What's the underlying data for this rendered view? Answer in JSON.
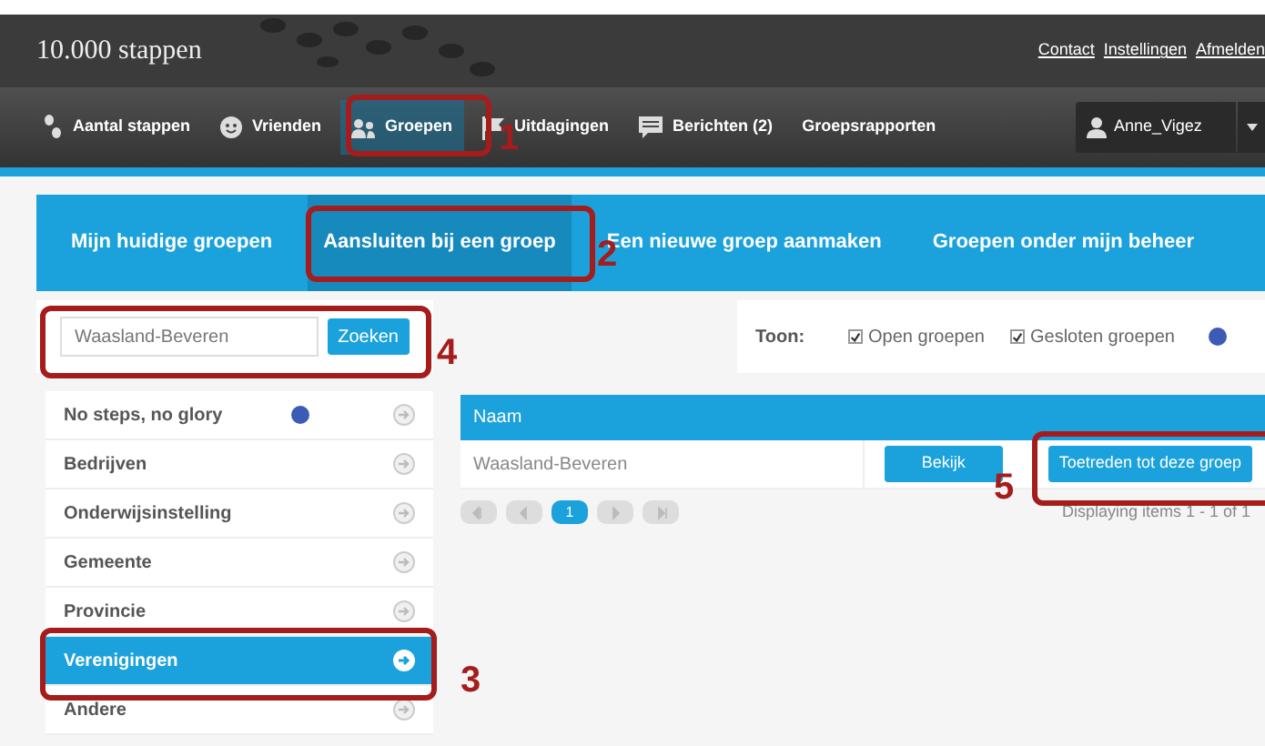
{
  "header": {
    "title": "10.000 stappen",
    "links": [
      "Contact",
      "Instellingen",
      "Afmelden"
    ]
  },
  "nav": {
    "items": [
      {
        "label": "Aantal stappen",
        "kind": "steps",
        "selected": false
      },
      {
        "label": "Vrienden",
        "kind": "smiley",
        "selected": false
      },
      {
        "label": "Groepen",
        "kind": "group",
        "selected": true
      },
      {
        "label": "Uitdagingen",
        "kind": "flag",
        "selected": false
      },
      {
        "label": "Berichten (2)",
        "kind": "message",
        "selected": false
      },
      {
        "label": "Groepsrapporten",
        "kind": "none",
        "selected": false
      }
    ],
    "user": "Anne_Vigez"
  },
  "tabs": [
    {
      "label": "Mijn huidige groepen",
      "selected": false
    },
    {
      "label": "Aansluiten bij een groep",
      "selected": true
    },
    {
      "label": "Een nieuwe groep aanmaken",
      "selected": false
    },
    {
      "label": "Groepen onder mijn beheer",
      "selected": false
    }
  ],
  "search": {
    "value": "Waasland-Beveren",
    "button": "Zoeken"
  },
  "filter": {
    "label": "Toon:",
    "options": [
      {
        "label": "Open groepen",
        "checked": true
      },
      {
        "label": "Gesloten groepen",
        "checked": true
      }
    ]
  },
  "categories": [
    {
      "label": "No steps, no glory",
      "info": true,
      "selected": false
    },
    {
      "label": "Bedrijven",
      "info": false,
      "selected": false
    },
    {
      "label": "Onderwijsinstelling",
      "info": false,
      "selected": false
    },
    {
      "label": "Gemeente",
      "info": false,
      "selected": false
    },
    {
      "label": "Provincie",
      "info": false,
      "selected": false
    },
    {
      "label": "Verenigingen",
      "info": false,
      "selected": true
    },
    {
      "label": "Andere",
      "info": false,
      "selected": false
    }
  ],
  "table": {
    "columns": [
      "Naam"
    ],
    "rows": [
      {
        "name": "Waasland-Beveren",
        "buttons": [
          "Bekijk",
          "Toetreden tot deze groep"
        ]
      }
    ],
    "pager": [
      {
        "kind": "first",
        "selected": false
      },
      {
        "kind": "prev",
        "selected": false
      },
      {
        "kind": "page",
        "label": "1",
        "selected": true
      },
      {
        "kind": "next",
        "selected": false
      },
      {
        "kind": "last",
        "selected": false
      }
    ],
    "status": "Displaying items 1 - 1 of 1"
  },
  "annotations": [
    {
      "label": "1"
    },
    {
      "label": "2"
    },
    {
      "label": "4"
    },
    {
      "label": "3"
    },
    {
      "label": "5"
    }
  ]
}
